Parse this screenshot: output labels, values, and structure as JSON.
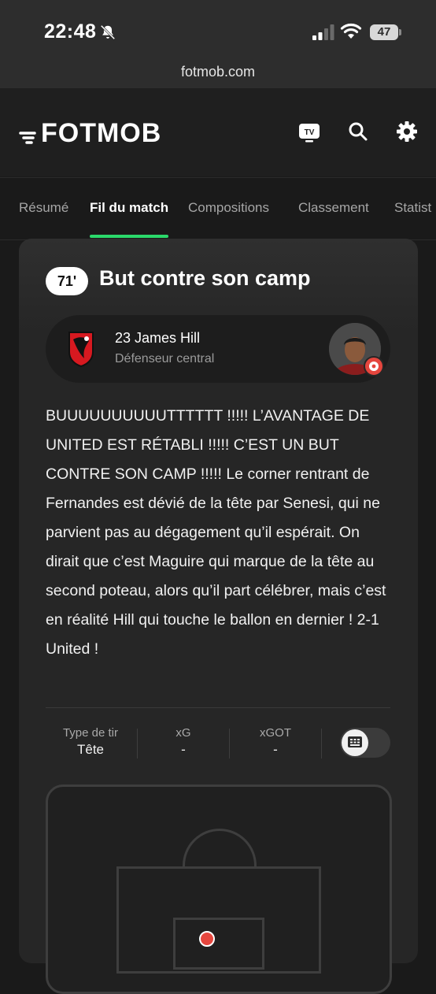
{
  "status_bar": {
    "time": "22:48",
    "battery": "47"
  },
  "browser": {
    "url": "fotmob.com"
  },
  "header": {
    "logo": "FOTMOB",
    "tv_label": "TV"
  },
  "tabs": [
    {
      "label": "Résumé"
    },
    {
      "label": "Fil du match"
    },
    {
      "label": "Compositions"
    },
    {
      "label": "Classement"
    },
    {
      "label": "Statist"
    }
  ],
  "event": {
    "minute": "71'",
    "title": "But contre son camp",
    "player_name": "23 James Hill",
    "player_role": "Défenseur central",
    "commentary": "BUUUUUUUUUUTTTTTT !!!!! L’AVANTAGE DE UNITED EST RÉTABLI !!!!! C’EST UN BUT CONTRE SON CAMP !!!!! Le corner rentrant de Fernandes est dévié de la tête par Senesi, qui ne parvient pas au dégagement qu’il espérait. On dirait que c’est Maguire qui marque de la tête au second poteau, alors qu’il part célébrer, mais c’est en réalité Hill qui touche le ballon en dernier ! 2-1 United !"
  },
  "shot_stats": [
    {
      "label": "Type de tir",
      "value": "Tête"
    },
    {
      "label": "xG",
      "value": "-"
    },
    {
      "label": "xGOT",
      "value": "-"
    }
  ],
  "colors": {
    "accent": "#2bd96b",
    "goal": "#e5463e",
    "crest_red": "#d71920"
  },
  "icons": [
    "bell-muted-icon",
    "signal-icon",
    "wifi-icon",
    "tv-icon",
    "search-icon",
    "gear-icon",
    "pitch-view-icon",
    "goal-ball-icon"
  ]
}
